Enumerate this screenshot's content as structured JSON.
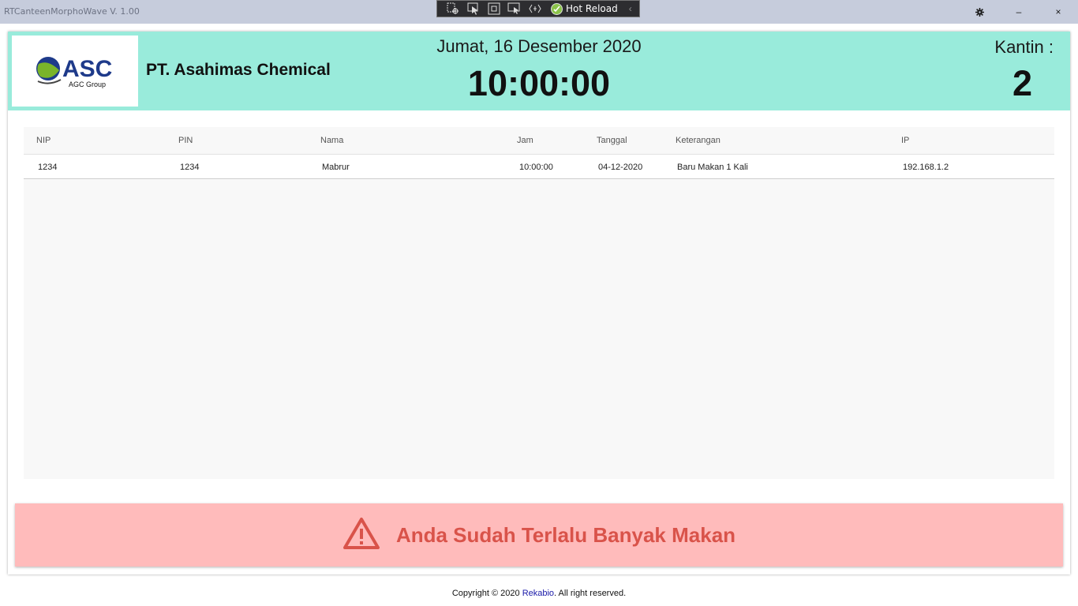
{
  "titlebar": {
    "app_title": "RTCanteenMorphoWave V. 1.00",
    "hot_reload_label": "Hot Reload",
    "minimize_glyph": "–",
    "close_glyph": "×",
    "icons": [
      "select-element-icon",
      "pointer-icon",
      "layout-adorner-icon",
      "track-focus-icon",
      "binding-failures-icon",
      "settings-gear-icon"
    ]
  },
  "header": {
    "company_name": "PT. Asahimas Chemical",
    "logo": {
      "brand": "ASC",
      "sub": "AGC Group"
    },
    "date": "Jumat, 16 Desember 2020",
    "time": "10:00:00",
    "kantin_label": "Kantin :",
    "kantin_value": "2",
    "background_color": "#99ebdb"
  },
  "table": {
    "columns": [
      "NIP",
      "PIN",
      "Nama",
      "Jam",
      "Tanggal",
      "Keterangan",
      "IP"
    ],
    "rows": [
      {
        "nip": "1234",
        "pin": "1234",
        "nama": "Mabrur",
        "jam": "10:00:00",
        "tanggal": "04-12-2020",
        "keterangan": "Baru Makan 1 Kali",
        "ip": "192.168.1.2"
      }
    ]
  },
  "warning": {
    "message": "Anda Sudah Terlalu Banyak Makan",
    "icon": "warning-triangle-icon",
    "background_color": "#ffbbbb",
    "text_color": "#d9534a"
  },
  "footer": {
    "prefix": "Copyright © 2020 ",
    "brand": "Rekabio",
    "suffix": ". All right reserved."
  }
}
